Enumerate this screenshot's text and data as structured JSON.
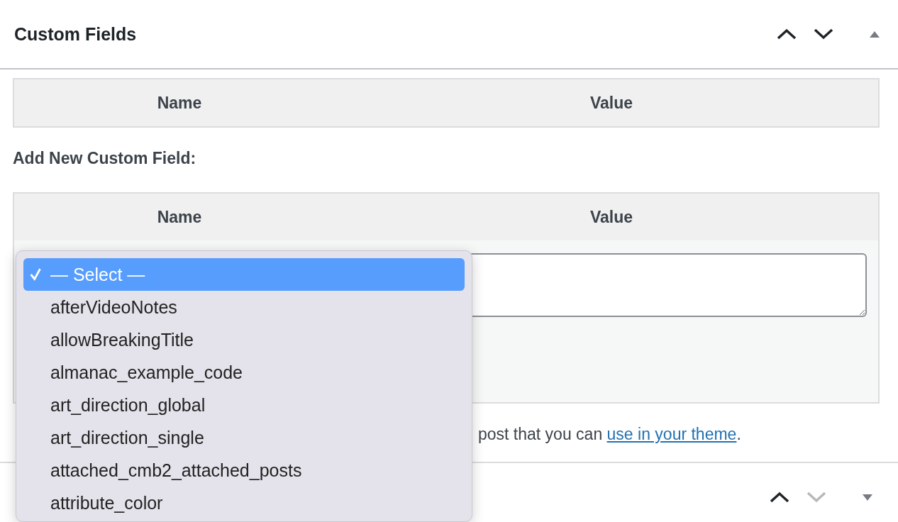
{
  "panel": {
    "title": "Custom Fields",
    "controls": [
      {
        "kind": "up",
        "disabled": false
      },
      {
        "kind": "down",
        "disabled": false
      },
      {
        "kind": "toggle",
        "expanded": true
      }
    ],
    "existing_table": {
      "columns": [
        "Name",
        "Value"
      ]
    },
    "add_heading": "Add New Custom Field:",
    "add_table": {
      "columns": [
        "Name",
        "Value"
      ]
    },
    "note": {
      "text": "post that you can ",
      "link": "use in your theme",
      "end": "."
    }
  },
  "next_panel": {
    "controls": [
      {
        "kind": "up",
        "disabled": false
      },
      {
        "kind": "down",
        "disabled": true
      },
      {
        "kind": "toggle",
        "expanded": false
      }
    ]
  },
  "dropdown": {
    "options": [
      {
        "label": "— Select —",
        "selected": true
      },
      {
        "label": "afterVideoNotes",
        "selected": false
      },
      {
        "label": "allowBreakingTitle",
        "selected": false
      },
      {
        "label": "almanac_example_code",
        "selected": false
      },
      {
        "label": "art_direction_global",
        "selected": false
      },
      {
        "label": "art_direction_single",
        "selected": false
      },
      {
        "label": "attached_cmb2_attached_posts",
        "selected": false
      },
      {
        "label": "attribute_color",
        "selected": false
      }
    ]
  }
}
